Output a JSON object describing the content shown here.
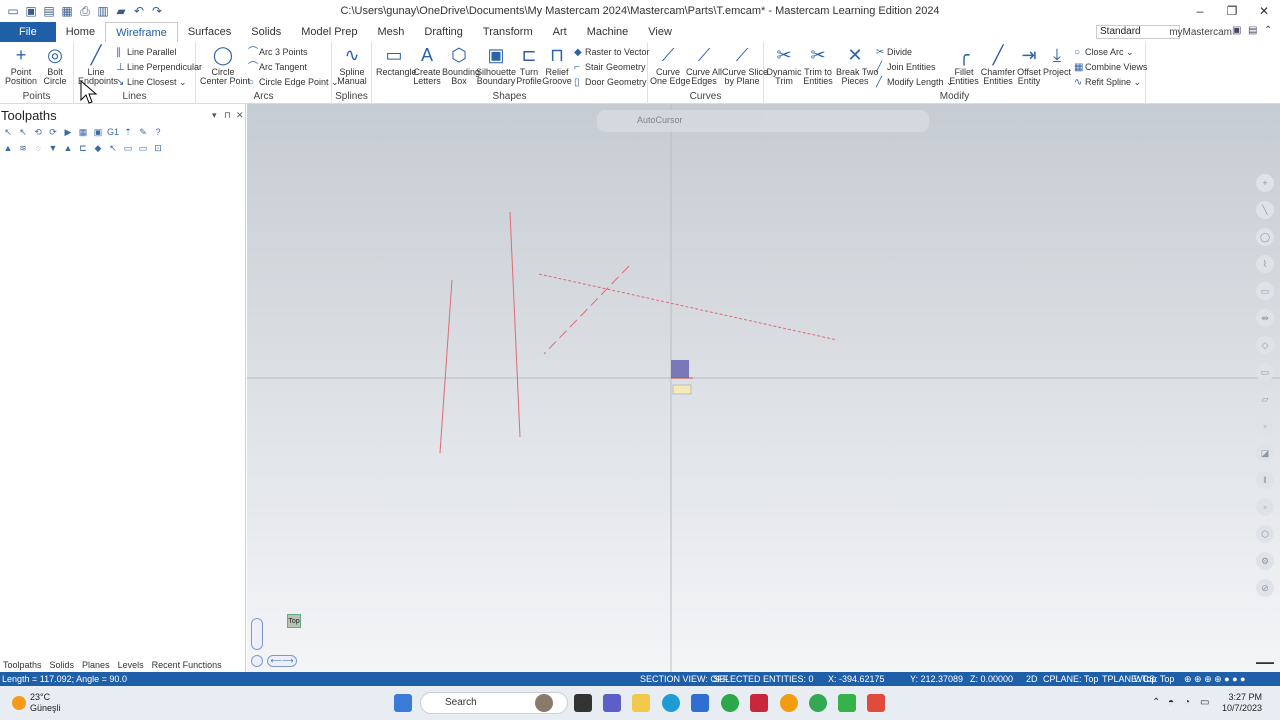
{
  "title_bar": {
    "title": "C:\\Users\\gunay\\OneDrive\\Documents\\My Mastercam 2024\\Mastercam\\Parts\\T.emcam* - Mastercam Learning Edition 2024"
  },
  "tabs": [
    "File",
    "Home",
    "Wireframe",
    "Surfaces",
    "Solids",
    "Model Prep",
    "Mesh",
    "Drafting",
    "Transform",
    "Art",
    "Machine",
    "View"
  ],
  "active_tab": "Wireframe",
  "standard_select": "Standard",
  "my_mastercam": "myMastercam",
  "ribbon": {
    "points": {
      "label": "Points",
      "point_position": "Point\nPosition",
      "bolt_circle": "Bolt\nCircle"
    },
    "lines": {
      "label": "Lines",
      "line_endpoints": "Line\nEndpoints",
      "line_parallel": "Line Parallel",
      "line_perpendicular": "Line Perpendicular",
      "line_closest": "Line Closest"
    },
    "arcs": {
      "label": "Arcs",
      "circle_center_point": "Circle\nCenter Point",
      "arc_3_points": "Arc 3 Points",
      "arc_tangent": "Arc Tangent",
      "circle_edge_point": "Circle Edge Point"
    },
    "splines": {
      "label": "Splines",
      "spline_manual": "Spline\nManual"
    },
    "shapes": {
      "label": "Shapes",
      "rectangle": "Rectangle",
      "create_letters": "Create\nLetters",
      "bounding_box": "Bounding\nBox",
      "silhouette_boundary": "Silhouette\nBoundary",
      "turn_profile": "Turn\nProfile",
      "relief_groove": "Relief\nGroove",
      "raster_to_vector": "Raster to Vector",
      "stair_geometry": "Stair Geometry",
      "door_geometry": "Door Geometry"
    },
    "curves": {
      "label": "Curves",
      "curve_one_edge": "Curve\nOne Edge",
      "curve_all_edges": "Curve All\nEdges",
      "curve_slice_by_plane": "Curve Slice\nby Plane"
    },
    "modify": {
      "label": "Modify",
      "dynamic_trim": "Dynamic\nTrim",
      "trim_to_entities": "Trim to\nEntities",
      "break_two_pieces": "Break Two\nPieces",
      "divide": "Divide",
      "join_entities": "Join Entities",
      "modify_length": "Modify Length",
      "fillet_entities": "Fillet\nEntities",
      "chamfer_entities": "Chamfer\nEntities",
      "offset_entity": "Offset\nEntity",
      "project": "Project",
      "close_arc": "Close Arc",
      "combine_views": "Combine Views",
      "refit_spline": "Refit Spline"
    }
  },
  "left_panel": {
    "title": "Toolpaths",
    "tabs": [
      "Toolpaths",
      "Solids",
      "Planes",
      "Levels",
      "Recent Functions"
    ]
  },
  "viewport": {
    "autocursor": "AutoCursor",
    "gnomon": "Top"
  },
  "status_bar": {
    "length_angle": "Length = 117.092; Angle = 90.0",
    "section_view": "SECTION VIEW: OFF",
    "selected": "SELECTED ENTITIES: 0",
    "x": "X:   -394.62175",
    "y": "Y:   212.37089",
    "z": "Z:   0.00000",
    "dim": "2D",
    "cplane": "CPLANE: Top",
    "tplane": "TPLANE: Top",
    "wcs": "WCS: Top"
  },
  "taskbar": {
    "temp": "23°C",
    "weather": "Güneşli",
    "search": "Search",
    "time": "3:27 PM",
    "date": "10/7/2023"
  },
  "colors": {
    "accent": "#1f5fa8",
    "wire": "#e06a74",
    "viewport_top": "#c6ccd3",
    "viewport_bottom": "#f4f5f7"
  }
}
